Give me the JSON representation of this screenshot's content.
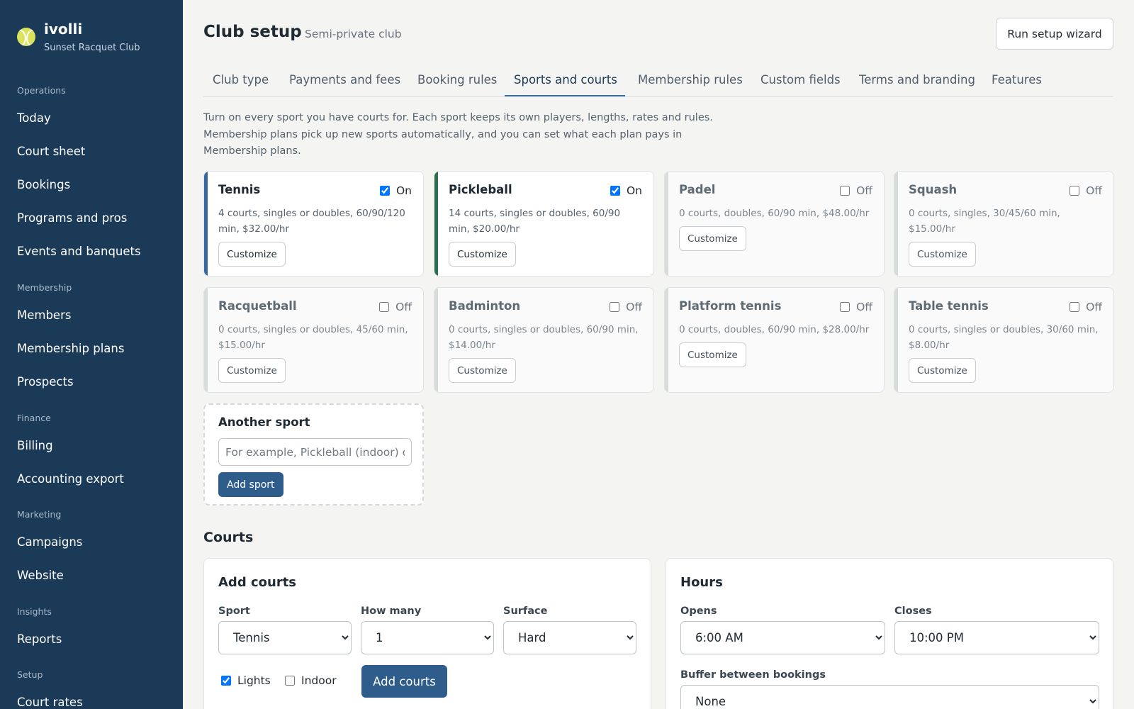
{
  "brand": {
    "name": "ivolli",
    "club": "Sunset Racquet Club"
  },
  "nav": {
    "operations": "Operations",
    "today": "Today",
    "court_sheet": "Court sheet",
    "bookings": "Bookings",
    "programs": "Programs and pros",
    "events": "Events and banquets",
    "membership": "Membership",
    "members": "Members",
    "membership_plans": "Membership plans",
    "prospects": "Prospects",
    "finance": "Finance",
    "billing": "Billing",
    "accounting_export": "Accounting export",
    "marketing": "Marketing",
    "campaigns": "Campaigns",
    "website": "Website",
    "insights": "Insights",
    "reports": "Reports",
    "setup": "Setup",
    "court_rates": "Court rates"
  },
  "header": {
    "title": "Club setup",
    "subtitle": "Semi-private club",
    "wizard_button": "Run setup wizard"
  },
  "tabs": [
    {
      "label": "Club type"
    },
    {
      "label": "Payments and fees"
    },
    {
      "label": "Booking rules"
    },
    {
      "label": "Sports and courts",
      "active": true
    },
    {
      "label": "Membership rules"
    },
    {
      "label": "Custom fields"
    },
    {
      "label": "Terms and branding"
    },
    {
      "label": "Features"
    }
  ],
  "intro": "Turn on every sport you have courts for. Each sport keeps its own players, lengths, rates and rules. Membership plans pick up new sports automatically, and you can set what each plan pays in Membership plans.",
  "sports": [
    {
      "name": "Tennis",
      "state": "On",
      "on": true,
      "description": "4 courts, singles or doubles, 60/90/120 min, $32.00/hr",
      "customize": "Customize"
    },
    {
      "name": "Pickleball",
      "state": "On",
      "on": true,
      "description": "14 courts, singles or doubles, 60/90 min, $20.00/hr",
      "customize": "Customize"
    },
    {
      "name": "Padel",
      "state": "Off",
      "on": false,
      "description": "0 courts, doubles, 60/90 min, $48.00/hr",
      "customize": "Customize"
    },
    {
      "name": "Squash",
      "state": "Off",
      "on": false,
      "description": "0 courts, singles, 30/45/60 min, $15.00/hr",
      "customize": "Customize"
    },
    {
      "name": "Racquetball",
      "state": "Off",
      "on": false,
      "description": "0 courts, singles or doubles, 45/60 min, $15.00/hr",
      "customize": "Customize"
    },
    {
      "name": "Badminton",
      "state": "Off",
      "on": false,
      "description": "0 courts, singles or doubles, 60/90 min, $14.00/hr",
      "customize": "Customize"
    },
    {
      "name": "Platform tennis",
      "state": "Off",
      "on": false,
      "description": "0 courts, doubles, 60/90 min, $28.00/hr",
      "customize": "Customize"
    },
    {
      "name": "Table tennis",
      "state": "Off",
      "on": false,
      "description": "0 courts, singles or doubles, 30/60 min, $8.00/hr",
      "customize": "Customize"
    }
  ],
  "another_sport": {
    "title": "Another sport",
    "placeholder": "For example, Pickleball (indoor) or Beach tennis",
    "button": "Add sport"
  },
  "courts": {
    "title": "Courts",
    "add_courts": {
      "title": "Add courts",
      "sport_label": "Sport",
      "sport_value": "Tennis",
      "how_many_label": "How many",
      "how_many_value": "1",
      "surface_label": "Surface",
      "surface_value": "Hard",
      "lights_label": "Lights",
      "lights_checked": true,
      "indoor_label": "Indoor",
      "indoor_checked": false,
      "button": "Add courts"
    },
    "hours": {
      "title": "Hours",
      "opens_label": "Opens",
      "opens_value": "6:00 AM",
      "closes_label": "Closes",
      "closes_value": "10:00 PM",
      "buffer_label": "Buffer between bookings",
      "buffer_value": "None"
    }
  }
}
